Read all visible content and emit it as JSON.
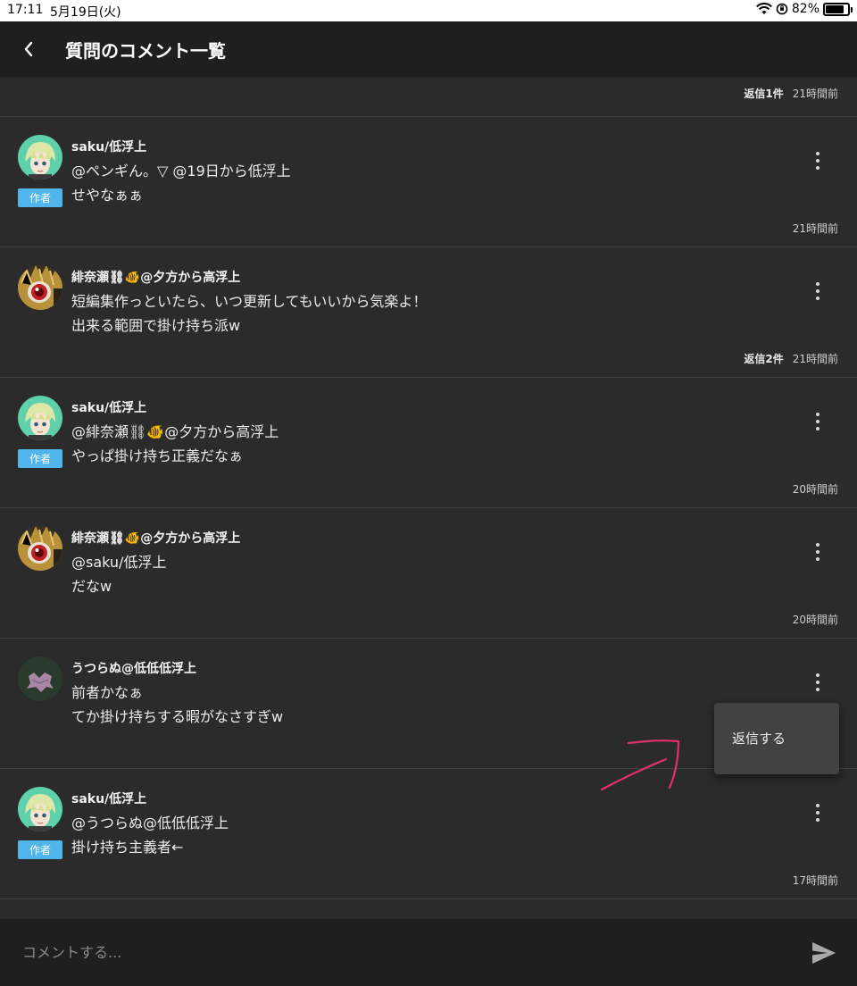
{
  "status_bar": {
    "time": "17:11",
    "date": "5月19日(火)",
    "battery": "82%",
    "battery_level": 0.82
  },
  "header": {
    "title": "質問のコメント一覧"
  },
  "top_meta": {
    "reply_count": "返信1件",
    "time": "21時間前"
  },
  "comments": [
    {
      "author": "saku/低浮上",
      "badge": "作者",
      "line1": "@ペンギん。▽ @19日から低浮上",
      "line2": "せやなぁぁ",
      "reply_count": "",
      "time": "21時間前"
    },
    {
      "author": "緋奈瀬⛓🐠@夕方から高浮上",
      "badge": "",
      "line1": "短編集作っといたら、いつ更新してもいいから気楽よ！",
      "line2": "出来る範囲で掛け持ち派w",
      "reply_count": "返信2件",
      "time": "21時間前"
    },
    {
      "author": "saku/低浮上",
      "badge": "作者",
      "line1": "@緋奈瀬⛓🐠@夕方から高浮上",
      "line2": "やっぱ掛け持ち正義だなぁ",
      "reply_count": "",
      "time": "20時間前"
    },
    {
      "author": "緋奈瀬⛓🐠@夕方から高浮上",
      "badge": "",
      "line1": "@saku/低浮上",
      "line2": "だなw",
      "reply_count": "",
      "time": "20時間前"
    },
    {
      "author": "うつらぬ@低低低浮上",
      "badge": "",
      "line1": "前者かなぁ",
      "line2": "てか掛け持ちする暇がなさすぎw",
      "reply_count": "",
      "time": ""
    },
    {
      "author": "saku/低浮上",
      "badge": "作者",
      "line1": "@うつらぬ@低低低浮上",
      "line2": "掛け持ち主義者←",
      "reply_count": "",
      "time": "17時間前"
    }
  ],
  "dropdown": {
    "reply_label": "返信する"
  },
  "footer": {
    "placeholder": "コメントする..."
  },
  "colors": {
    "background": "#2b2b2b",
    "header": "#1f1f1f",
    "badge": "#4fb5ea",
    "annotation": "#e0306e"
  }
}
